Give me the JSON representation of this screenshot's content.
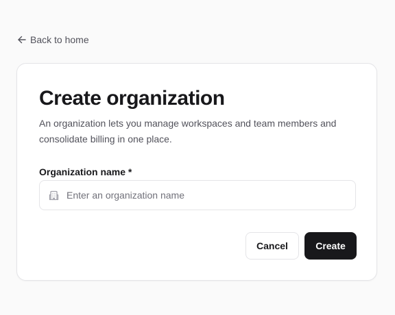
{
  "nav": {
    "back_label": "Back to home"
  },
  "form": {
    "title": "Create organization",
    "description": "An organization lets you manage workspaces and team members and consolidate billing in one place.",
    "name_label": "Organization name *",
    "name_placeholder": "Enter an organization name",
    "name_value": ""
  },
  "actions": {
    "cancel_label": "Cancel",
    "create_label": "Create"
  },
  "icons": {
    "back": "arrow-left-icon",
    "field": "building-icon"
  },
  "colors": {
    "primary_button": "#18181b",
    "background": "#fafafa",
    "card": "#ffffff",
    "border": "#e4e4e7",
    "muted_text": "#52525b"
  }
}
